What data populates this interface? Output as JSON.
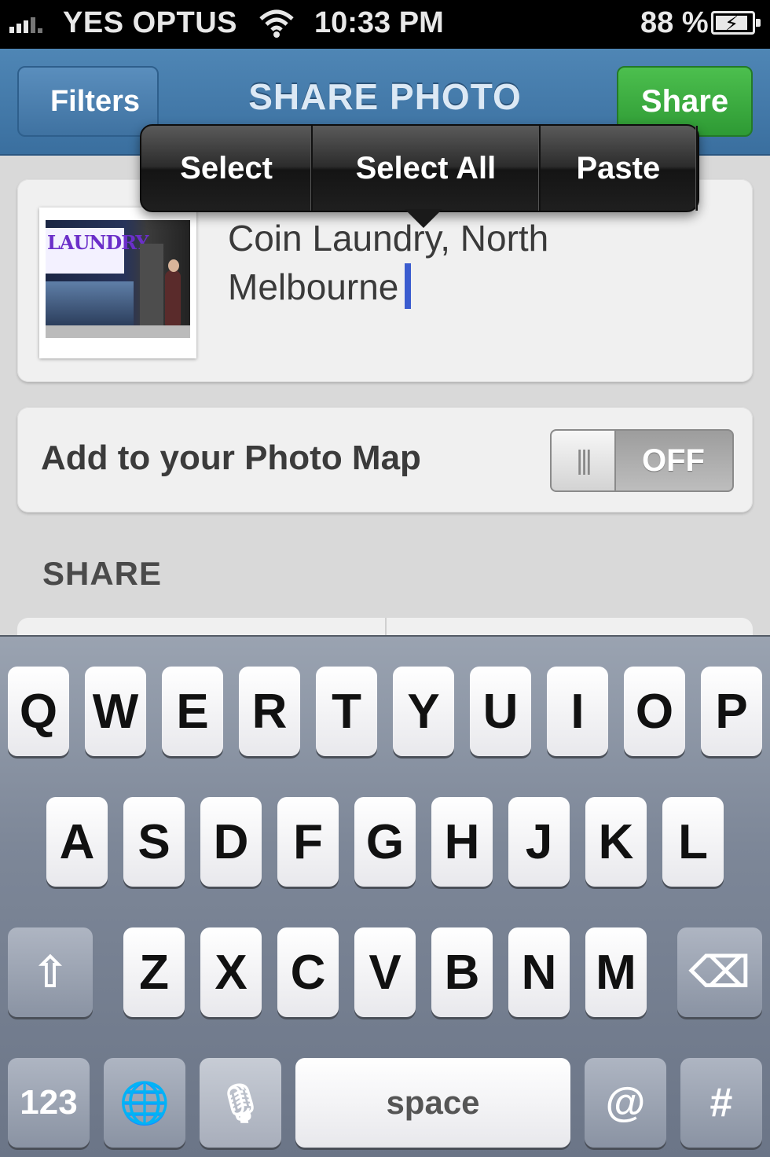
{
  "status_bar": {
    "carrier": "YES OPTUS",
    "time": "10:33 PM",
    "battery_percent": "88 %",
    "signal_bars": 3
  },
  "nav": {
    "back_label": "Filters",
    "title": "SHARE PHOTO",
    "share_label": "Share"
  },
  "edit_menu": {
    "items": [
      "Select",
      "Select All",
      "Paste"
    ]
  },
  "caption": {
    "line1": "Coin Laundry, North",
    "line2": "Melbourne"
  },
  "thumbnail": {
    "sign_text": "LAUNDRY"
  },
  "photo_map": {
    "label": "Add to your Photo Map",
    "toggle_state": "OFF",
    "toggle_grip": "|||"
  },
  "share_section": {
    "header": "SHARE"
  },
  "keyboard": {
    "row1": [
      "Q",
      "W",
      "E",
      "R",
      "T",
      "Y",
      "U",
      "I",
      "O",
      "P"
    ],
    "row2": [
      "A",
      "S",
      "D",
      "F",
      "G",
      "H",
      "J",
      "K",
      "L"
    ],
    "row3": [
      "Z",
      "X",
      "C",
      "V",
      "B",
      "N",
      "M"
    ],
    "shift": "⇧",
    "delete": "⌫",
    "numbers": "123",
    "globe": "🌐",
    "mic": "🎙",
    "space": "space",
    "at": "@",
    "hash": "#"
  },
  "colors": {
    "nav_blue": "#4a80af",
    "share_green": "#3aab3e",
    "cursor_blue": "#3b5ccf"
  }
}
